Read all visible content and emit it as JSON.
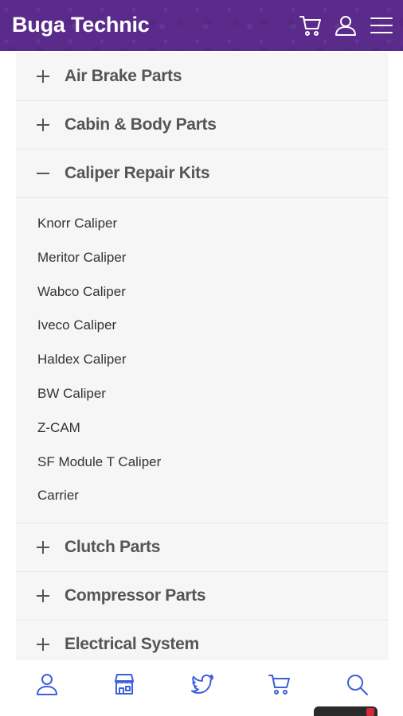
{
  "header": {
    "brand": "Buga Technic",
    "icons": [
      "cart-icon",
      "user-icon",
      "menu-icon"
    ],
    "background_color": "#5b2b8c"
  },
  "menu": {
    "categories_before": [
      {
        "label": "Air Brake Parts",
        "expanded": false
      },
      {
        "label": "Cabin & Body Parts",
        "expanded": false
      }
    ],
    "expanded_category": {
      "label": "Caliper Repair Kits",
      "expanded": true,
      "items": [
        "Knorr Caliper",
        "Meritor Caliper",
        "Wabco Caliper",
        "Iveco Caliper",
        "Haldex Caliper",
        "BW Caliper",
        "Z-CAM",
        "SF Module T Caliper",
        "Carrier"
      ]
    },
    "categories_after": [
      {
        "label": "Clutch Parts",
        "expanded": false
      },
      {
        "label": "Compressor Parts",
        "expanded": false
      },
      {
        "label": "Electrical System",
        "expanded": false
      }
    ]
  },
  "bottom_nav": {
    "icons": [
      "user-icon",
      "store-icon",
      "twitter-icon",
      "cart-icon",
      "search-icon"
    ],
    "icon_color": "#3d5fd9"
  }
}
